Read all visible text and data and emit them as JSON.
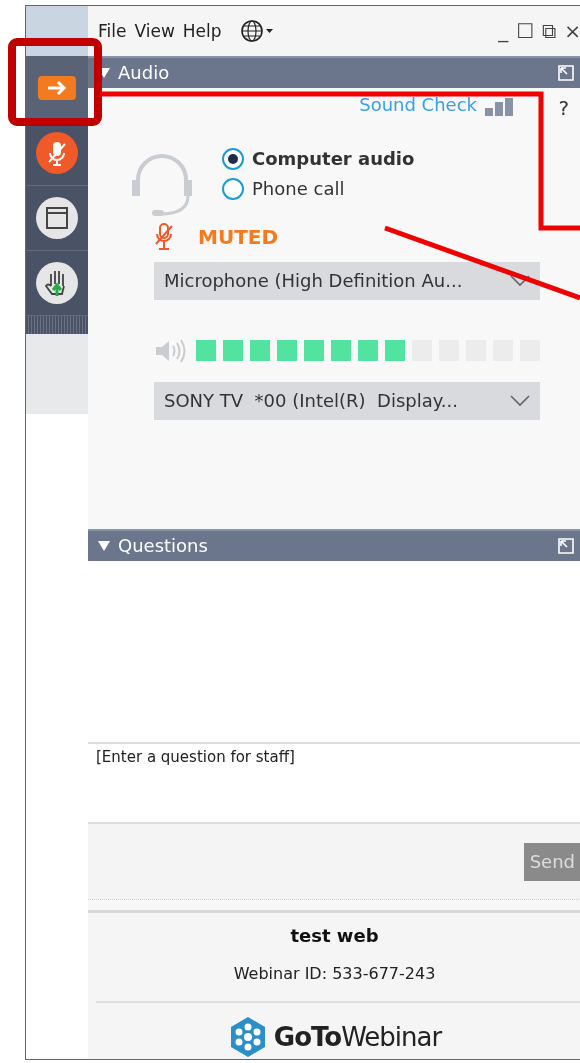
{
  "menu": [
    "File",
    "View",
    "Help"
  ],
  "window_controls": [
    "_",
    "☐",
    "⧉",
    "×"
  ],
  "sidebar": {
    "items": [
      {
        "kind": "arrow",
        "selected": true
      },
      {
        "kind": "mic-muted",
        "selected": false
      },
      {
        "kind": "window",
        "selected": false
      },
      {
        "kind": "hand",
        "selected": false
      }
    ]
  },
  "audio": {
    "title": "Audio",
    "expanded": true,
    "sound_check": "Sound Check",
    "help": "?",
    "options": [
      {
        "label": "Computer audio",
        "selected": true
      },
      {
        "label": "Phone call",
        "selected": false
      }
    ],
    "mic_status": "MUTED",
    "microphone": "Microphone (High Definition Au...",
    "level": 0.615,
    "speaker": "SONY TV  *00 (Intel(R)  Display..."
  },
  "questions": {
    "title": "Questions",
    "expanded": true,
    "placeholder": "[Enter a question for staff]",
    "send": {
      "label": "Send",
      "disabled": true
    }
  },
  "footer": {
    "title": "test web",
    "webinar_id": "Webinar ID: 533-677-243",
    "logo": "**GoTo**Webinar"
  }
}
